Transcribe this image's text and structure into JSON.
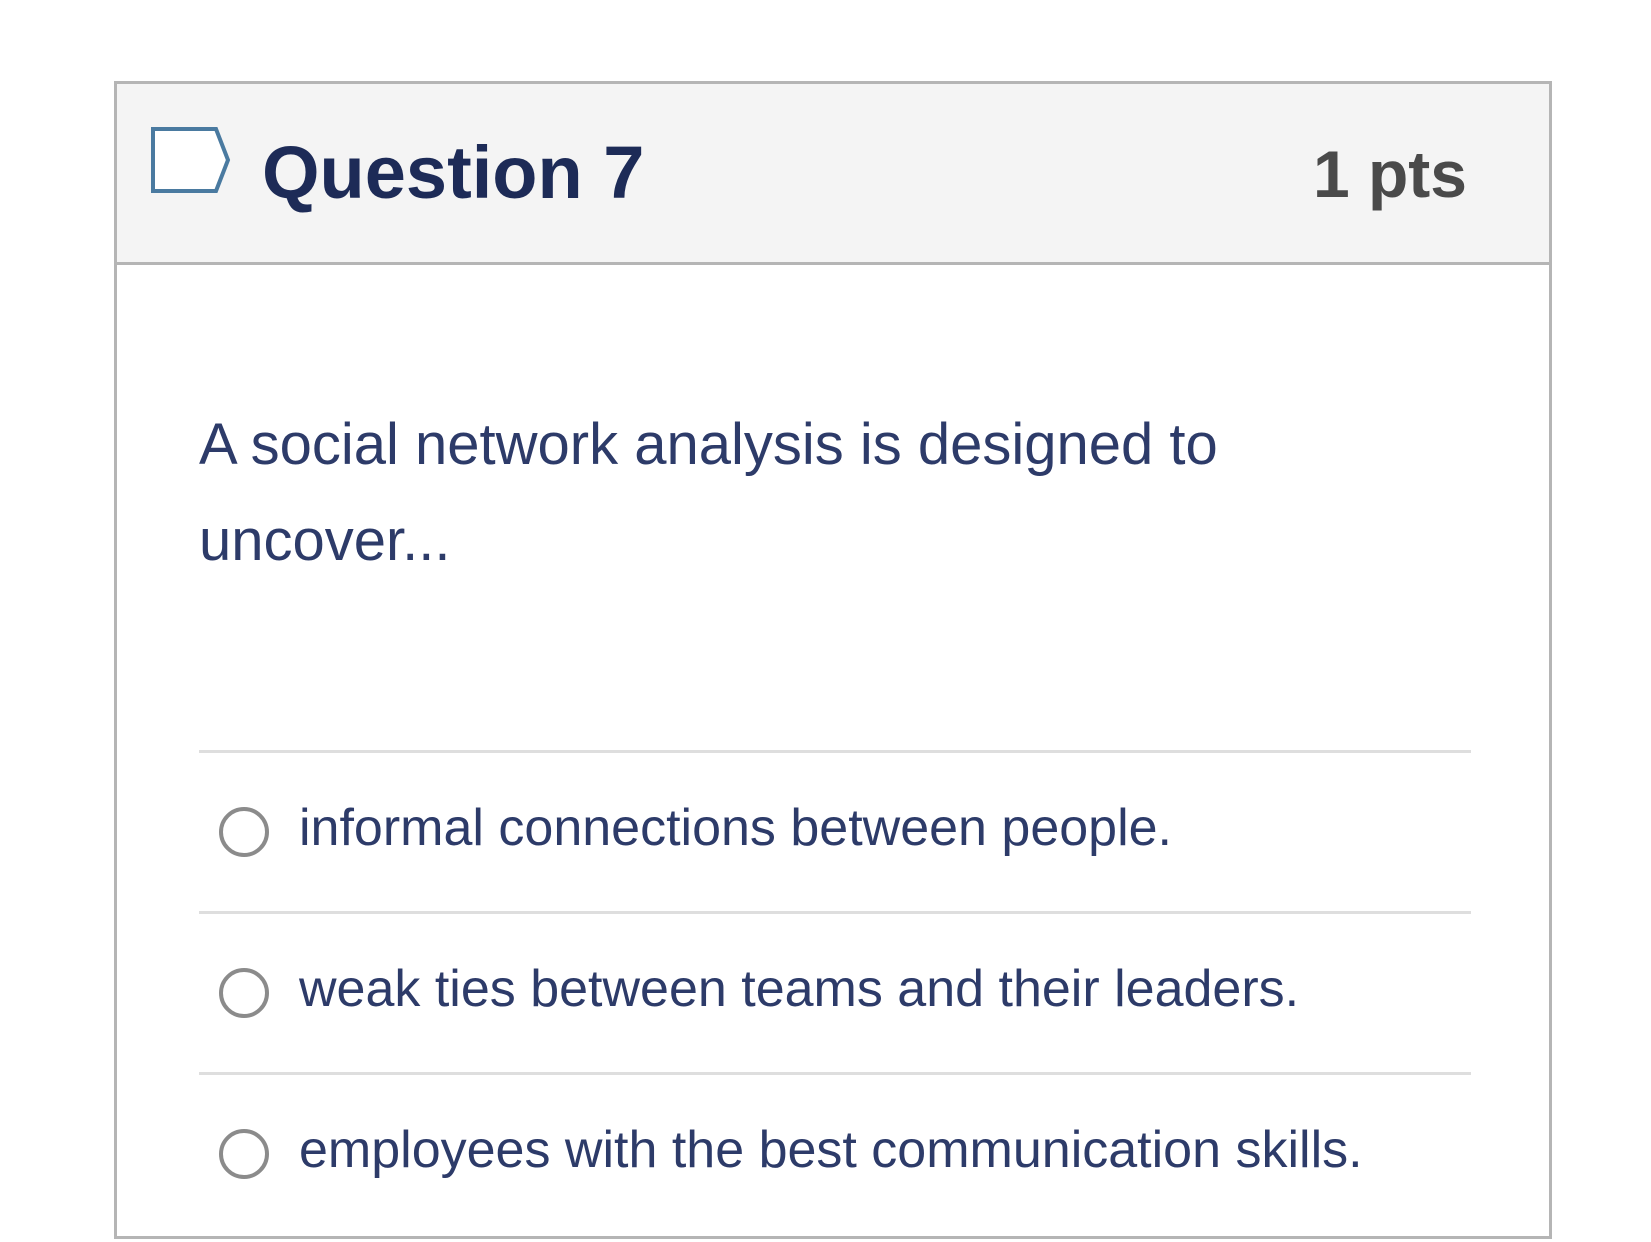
{
  "question": {
    "flag_icon": "flag-outline-icon",
    "title": "Question 7",
    "points": "1 pts",
    "text": "A social network analysis is designed to uncover...",
    "colors": {
      "title": "#1d2b57",
      "text": "#2d3b69",
      "header_background": "#f4f4f4",
      "border": "#b5b5b5",
      "flag": "#4a7aa0",
      "radio": "#8b8b8b"
    }
  },
  "answers": [
    {
      "label": "informal connections between people.",
      "selected": false
    },
    {
      "label": "weak ties between teams and their leaders.",
      "selected": false
    },
    {
      "label": "employees with the best communication skills.",
      "selected": false
    }
  ]
}
